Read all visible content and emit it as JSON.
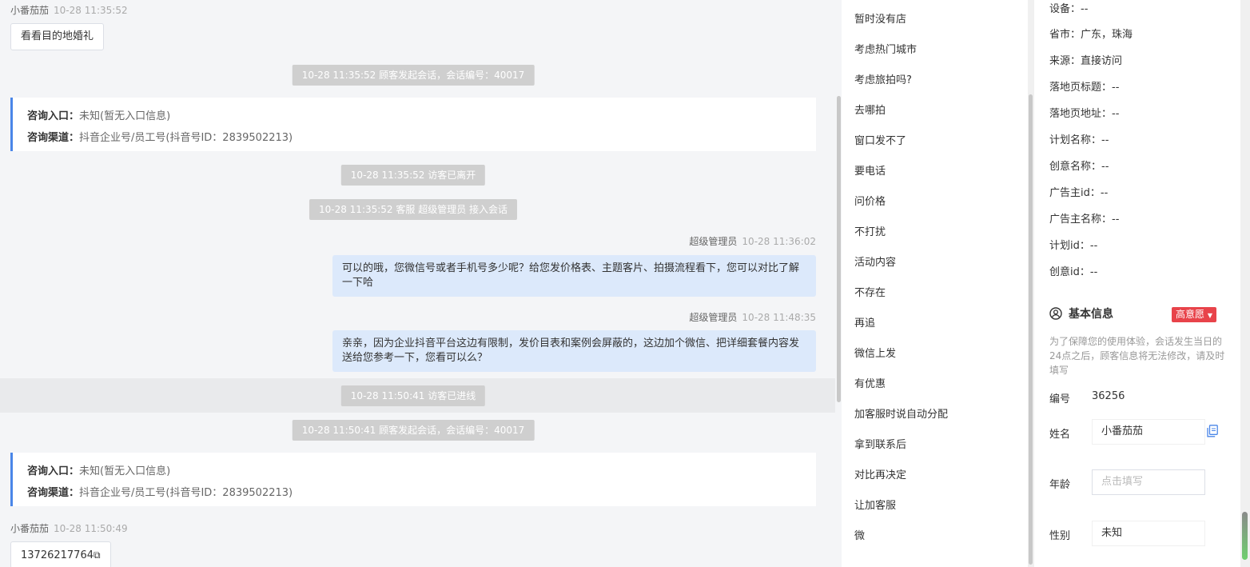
{
  "chat": {
    "messages": [
      {
        "sender": "小番茄茄",
        "time": "10-28 11:35:52"
      },
      {
        "text": "看看目的地婚礼"
      },
      {
        "system": "10-28 11:35:52 顾客发起会话，会话编号：40017"
      },
      {
        "entry_label": "咨询入口：",
        "entry_value": "未知(暂无入口信息)",
        "channel_label": "咨询渠道：",
        "channel_value": "抖音企业号/员工号(抖音号ID：2839502213)"
      },
      {
        "system": "10-28 11:35:52 访客已离开"
      },
      {
        "system": "10-28 11:35:52 客服 超级管理员 接入会话"
      },
      {
        "sender": "超级管理员",
        "time": "10-28 11:36:02"
      },
      {
        "text": "可以的哦，您微信号或者手机号多少呢？给您发价格表、主题客片、拍摄流程看下，您可以对比了解一下哈"
      },
      {
        "sender": "超级管理员",
        "time": "10-28 11:48:35"
      },
      {
        "text": "亲亲，因为企业抖音平台这边有限制，发价目表和案例会屏蔽的，这边加个微信、把详细套餐内容发送给您参考一下，您看可以么？"
      },
      {
        "system": "10-28 11:50:41 访客已进线"
      },
      {
        "system": "10-28 11:50:41 顾客发起会话，会话编号：40017"
      },
      {
        "entry_label": "咨询入口：",
        "entry_value": "未知(暂无入口信息)",
        "channel_label": "咨询渠道：",
        "channel_value": "抖音企业号/员工号(抖音号ID：2839502213)"
      },
      {
        "sender": "小番茄茄",
        "time": "10-28 11:50:49"
      },
      {
        "text": "13726217764",
        "icon": "copy-icon"
      }
    ]
  },
  "quick_replies": [
    "暂时没有店",
    "考虑热门城市",
    "考虑旅拍吗?",
    "去哪拍",
    "窗口发不了",
    "要电话",
    "问价格",
    "不打扰",
    "活动内容",
    "不存在",
    "再追",
    "微信上发",
    "有优惠",
    "加客服时说自动分配",
    "拿到联系后",
    "对比再决定",
    "让加客服",
    "微"
  ],
  "info": {
    "rows": [
      {
        "label": "设备：",
        "value": "--"
      },
      {
        "label": "省市：",
        "value": "广东，珠海"
      },
      {
        "label": "来源：",
        "value": "直接访问"
      },
      {
        "label": "落地页标题：",
        "value": "--"
      },
      {
        "label": "落地页地址：",
        "value": "--"
      },
      {
        "label": "计划名称：",
        "value": "--"
      },
      {
        "label": "创意名称：",
        "value": "--"
      },
      {
        "label": "广告主id：",
        "value": "--"
      },
      {
        "label": "广告主名称：",
        "value": "--"
      },
      {
        "label": "计划id：",
        "value": "--"
      },
      {
        "label": "创意id：",
        "value": "--"
      }
    ],
    "section_title": "基本信息",
    "section_icon": "user-circle-icon",
    "intent_badge": "高意愿",
    "intent_color": "#e8434a",
    "note": "为了保障您的使用体验，会话发生当日的24点之后，顾客信息将无法修改，请及时填写",
    "id_label": "编号",
    "id_value": "36256",
    "name_label": "姓名",
    "name_value": "小番茄茄",
    "age_label": "年龄",
    "age_placeholder": "点击填写",
    "gender_label": "性别",
    "gender_value": "未知"
  },
  "colors": {
    "accent": "#4a86e8",
    "bubble_out": "#dce9fb",
    "system": "#cfcfcf"
  }
}
